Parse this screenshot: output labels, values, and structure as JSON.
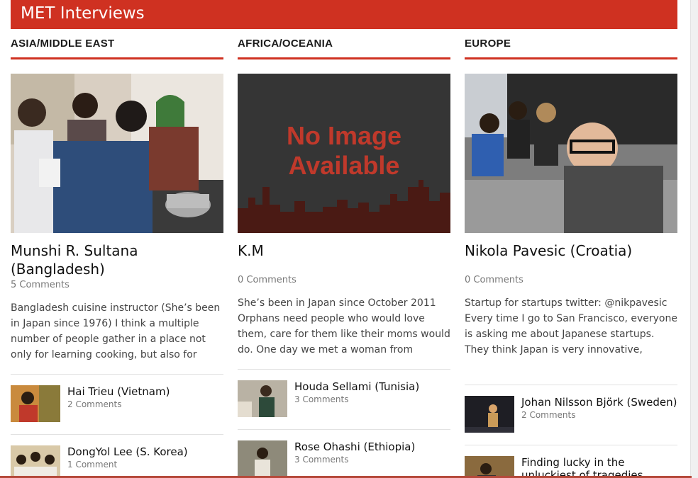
{
  "banner": {
    "title": "MET Interviews"
  },
  "colors": {
    "accent": "#cf3121"
  },
  "columns": [
    {
      "heading": "ASIA/MIDDLE EAST",
      "feature": {
        "image": "cooking-photo",
        "title": "Munshi R. Sultana (Bangladesh)",
        "comments": "5 Comments",
        "excerpt": "Bangladesh cuisine instructor (She’s been in Japan since 1976)   I think a multiple number of people gather in a place not only for learning cooking, but also for"
      },
      "items": [
        {
          "title": "Hai Trieu (Vietnam)",
          "comments": "2 Comments"
        },
        {
          "title": "DongYol Lee (S. Korea)",
          "comments": "1 Comment"
        }
      ]
    },
    {
      "heading": "AFRICA/OCEANIA",
      "feature": {
        "image": "no-image-placeholder",
        "placeholder_line1": "No Image",
        "placeholder_line2": "Available",
        "title": "K.M",
        "comments": "0 Comments",
        "excerpt": "She’s been in Japan since October 2011    Orphans need people who would love them, care for them like their moms would do.     One day we met a woman from"
      },
      "items": [
        {
          "title": "Houda Sellami (Tunisia)",
          "comments": "3 Comments"
        },
        {
          "title": "Rose Ohashi (Ethiopia)",
          "comments": "3 Comments"
        }
      ]
    },
    {
      "heading": "EUROPE",
      "feature": {
        "image": "selfie-photo",
        "title": "Nikola Pavesic (Croatia)",
        "comments": "0 Comments",
        "excerpt": "Startup for startups twitter: @nikpavesic   Every time I go to San Francisco, everyone is asking me about Japanese startups. They think Japan is very innovative,"
      },
      "items": [
        {
          "title": "Johan Nilsson Björk (Sweden)",
          "comments": "2 Comments"
        },
        {
          "title": "Finding lucky in the unluckiest of tragedies",
          "comments": ""
        }
      ]
    }
  ]
}
